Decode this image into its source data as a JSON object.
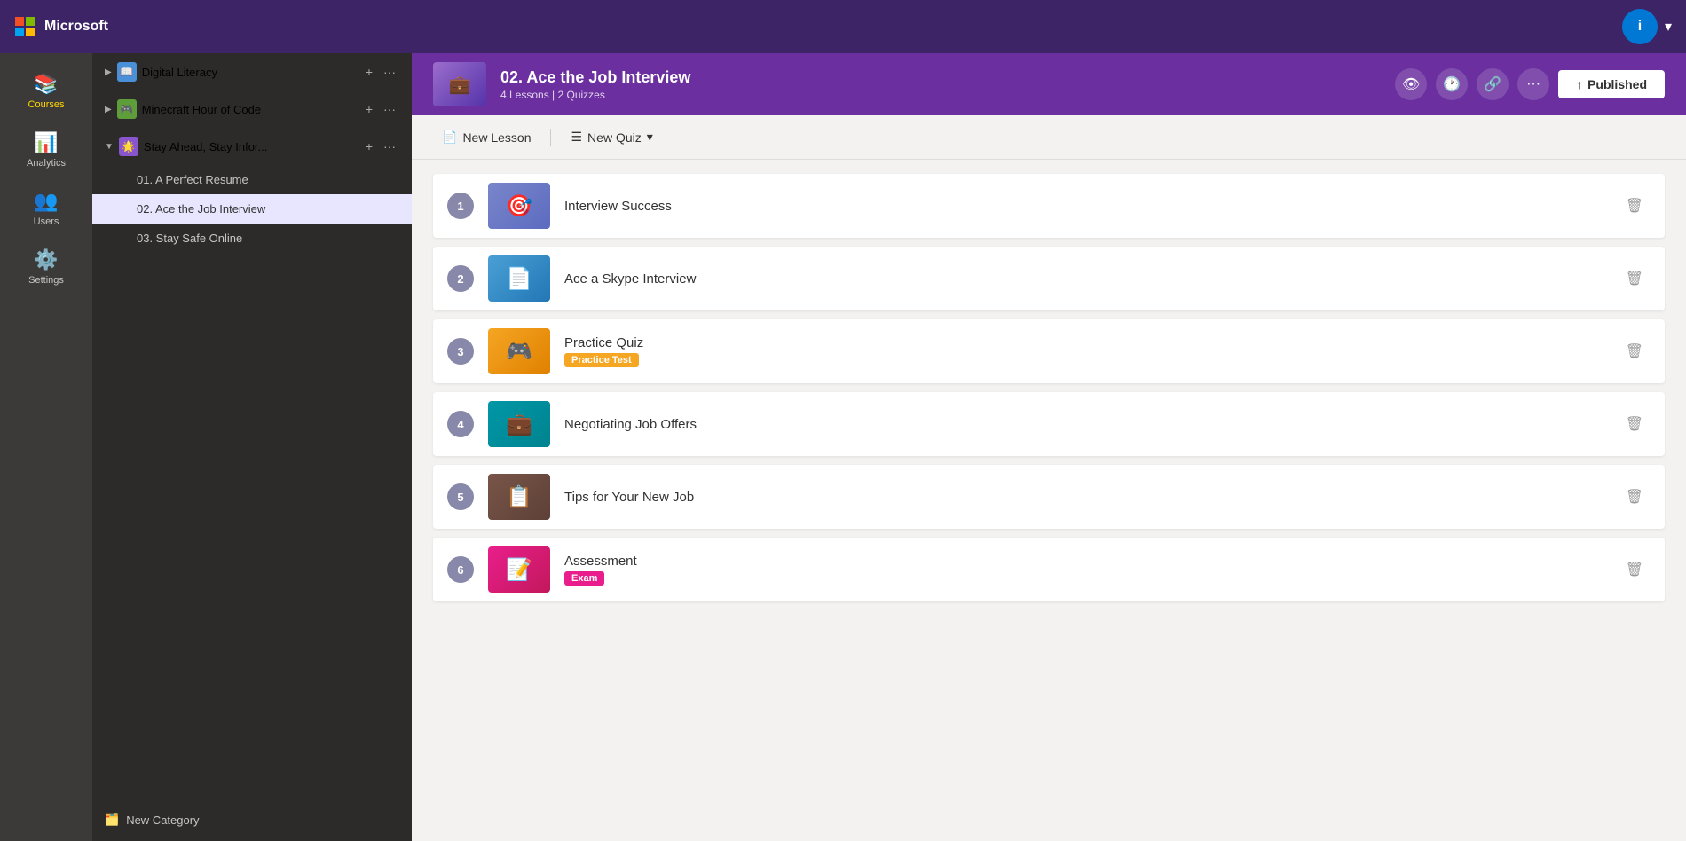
{
  "topbar": {
    "brand": "Microsoft",
    "user_initial": "i"
  },
  "nav": {
    "items": [
      {
        "id": "courses",
        "label": "Courses",
        "icon": "📚",
        "active": true
      },
      {
        "id": "analytics",
        "label": "Analytics",
        "icon": "📊",
        "active": false
      },
      {
        "id": "users",
        "label": "Users",
        "icon": "👥",
        "active": false
      },
      {
        "id": "settings",
        "label": "Settings",
        "icon": "⚙️",
        "active": false
      }
    ]
  },
  "sidebar": {
    "categories": [
      {
        "id": "digital-literacy",
        "label": "Digital Literacy",
        "expanded": false
      },
      {
        "id": "minecraft",
        "label": "Minecraft Hour of Code",
        "expanded": false
      },
      {
        "id": "stay-ahead",
        "label": "Stay Ahead, Stay Infor...",
        "expanded": true,
        "courses": [
          {
            "id": "01",
            "label": "01. A Perfect Resume",
            "active": false
          },
          {
            "id": "02",
            "label": "02. Ace the Job Interview",
            "active": true
          },
          {
            "id": "03",
            "label": "03. Stay Safe Online",
            "active": false
          }
        ]
      }
    ],
    "new_category_label": "New Category"
  },
  "course_header": {
    "title": "02. Ace the Job Interview",
    "meta": "4 Lessons | 2 Quizzes",
    "status": "Published"
  },
  "toolbar": {
    "new_lesson_label": "New Lesson",
    "new_quiz_label": "New Quiz",
    "quiz_dropdown_icon": "▾"
  },
  "lessons": [
    {
      "number": 1,
      "title": "Interview Success",
      "type": "lesson",
      "thumb_style": "interview",
      "thumb_icon": "🎯"
    },
    {
      "number": 2,
      "title": "Ace a Skype Interview",
      "type": "lesson",
      "thumb_style": "blue",
      "thumb_icon": "📄"
    },
    {
      "number": 3,
      "title": "Practice Quiz",
      "badge": "Practice Test",
      "badge_type": "practice",
      "type": "quiz",
      "thumb_style": "orange",
      "thumb_icon": "🎮"
    },
    {
      "number": 4,
      "title": "Negotiating Job Offers",
      "type": "lesson",
      "thumb_style": "teal",
      "thumb_icon": "💼"
    },
    {
      "number": 5,
      "title": "Tips for Your New Job",
      "type": "lesson",
      "thumb_style": "brown",
      "thumb_icon": "📋"
    },
    {
      "number": 6,
      "title": "Assessment",
      "badge": "Exam",
      "badge_type": "exam",
      "type": "quiz",
      "thumb_style": "pink",
      "thumb_icon": "📝"
    }
  ]
}
